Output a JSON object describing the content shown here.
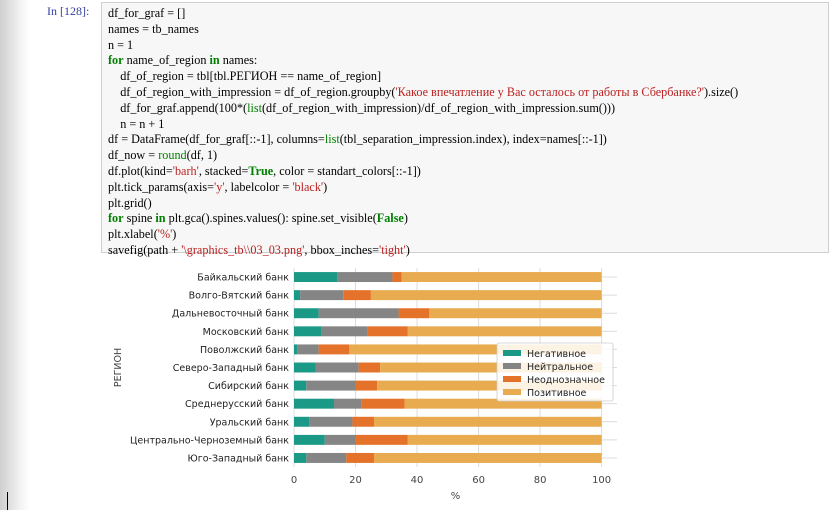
{
  "cell": {
    "prompt": "In [128]:",
    "code_lines": [
      [
        {
          "t": "df_for_graf = []"
        }
      ],
      [
        {
          "t": "names = tb_names"
        }
      ],
      [
        {
          "t": "n = 1"
        }
      ],
      [
        {
          "t": "for",
          "k": "kw"
        },
        {
          "t": " name_of_region "
        },
        {
          "t": "in",
          "k": "kw"
        },
        {
          "t": " names:"
        }
      ],
      [
        {
          "t": "    df_of_region = tbl[tbl.РЕГИОН == name_of_region]"
        }
      ],
      [
        {
          "t": "    df_of_region_with_impression = df_of_region.groupby("
        },
        {
          "t": "'Какое впечатление у Вас осталось от работы в Сбербанке?'",
          "k": "str"
        },
        {
          "t": ").size()"
        }
      ],
      [
        {
          "t": "    df_for_graf.append(100*("
        },
        {
          "t": "list",
          "k": "kw-n"
        },
        {
          "t": "(df_of_region_with_impression)/df_of_region_with_impression.sum()))"
        }
      ],
      [
        {
          "t": "    n = n + 1"
        }
      ],
      [
        {
          "t": "df = DataFrame(df_for_graf[::-1], columns="
        },
        {
          "t": "list",
          "k": "kw-n"
        },
        {
          "t": "(tbl_separation_impression.index), index=names[::-1])"
        }
      ],
      [
        {
          "t": "df_now = "
        },
        {
          "t": "round",
          "k": "kw-n"
        },
        {
          "t": "(df, 1)"
        }
      ],
      [
        {
          "t": "df.plot(kind="
        },
        {
          "t": "'barh'",
          "k": "str"
        },
        {
          "t": ", stacked="
        },
        {
          "t": "True",
          "k": "kw"
        },
        {
          "t": ", color = standart_colors[::-1])"
        }
      ],
      [
        {
          "t": "plt.tick_params(axis="
        },
        {
          "t": "'y'",
          "k": "str"
        },
        {
          "t": ", labelcolor = "
        },
        {
          "t": "'black'",
          "k": "str"
        },
        {
          "t": ")"
        }
      ],
      [
        {
          "t": "plt.grid()"
        }
      ],
      [
        {
          "t": "for",
          "k": "kw"
        },
        {
          "t": " spine "
        },
        {
          "t": "in",
          "k": "kw"
        },
        {
          "t": " plt.gca().spines.values(): spine.set_visible("
        },
        {
          "t": "False",
          "k": "kw"
        },
        {
          "t": ")"
        }
      ],
      [
        {
          "t": "plt.xlabel("
        },
        {
          "t": "'%'",
          "k": "str"
        },
        {
          "t": ")"
        }
      ],
      [
        {
          "t": "savefig(path + "
        },
        {
          "t": "'\\graphics_tb\\\\03_03.png'",
          "k": "str"
        },
        {
          "t": ", bbox_inches="
        },
        {
          "t": "'tight'",
          "k": "str"
        },
        {
          "t": ")"
        }
      ]
    ]
  },
  "chart_data": {
    "type": "bar",
    "orientation": "horizontal",
    "stacked": true,
    "xlabel": "%",
    "ylabel": "РЕГИОН",
    "xlim": [
      0,
      105
    ],
    "xticks": [
      0,
      20,
      40,
      60,
      80,
      100
    ],
    "grid": true,
    "legend_position": "center-right",
    "categories": [
      "Байкальский банк",
      "Волго-Вятский банк",
      "Дальневосточный банк",
      "Московский банк",
      "Поволжский банк",
      "Северо-Западный банк",
      "Сибирский банк",
      "Среднерусский банк",
      "Уральский банк",
      "Центрально-Черноземный банк",
      "Юго-Западный банк"
    ],
    "series": [
      {
        "name": "Негативное",
        "color": "#1a9a86",
        "values": [
          14,
          2,
          8,
          9,
          1,
          7,
          4,
          13,
          5,
          10,
          4
        ]
      },
      {
        "name": "Нейтральное",
        "color": "#858585",
        "values": [
          18,
          14,
          26,
          15,
          7,
          14,
          16,
          9,
          14,
          10,
          13
        ]
      },
      {
        "name": "Неоднозначное",
        "color": "#e4722a",
        "values": [
          3,
          9,
          10,
          13,
          10,
          7,
          7,
          14,
          7,
          17,
          9
        ]
      },
      {
        "name": "Позитивное",
        "color": "#e8ab4f",
        "values": [
          65,
          75,
          56,
          63,
          82,
          72,
          73,
          64,
          74,
          63,
          74
        ]
      }
    ]
  }
}
